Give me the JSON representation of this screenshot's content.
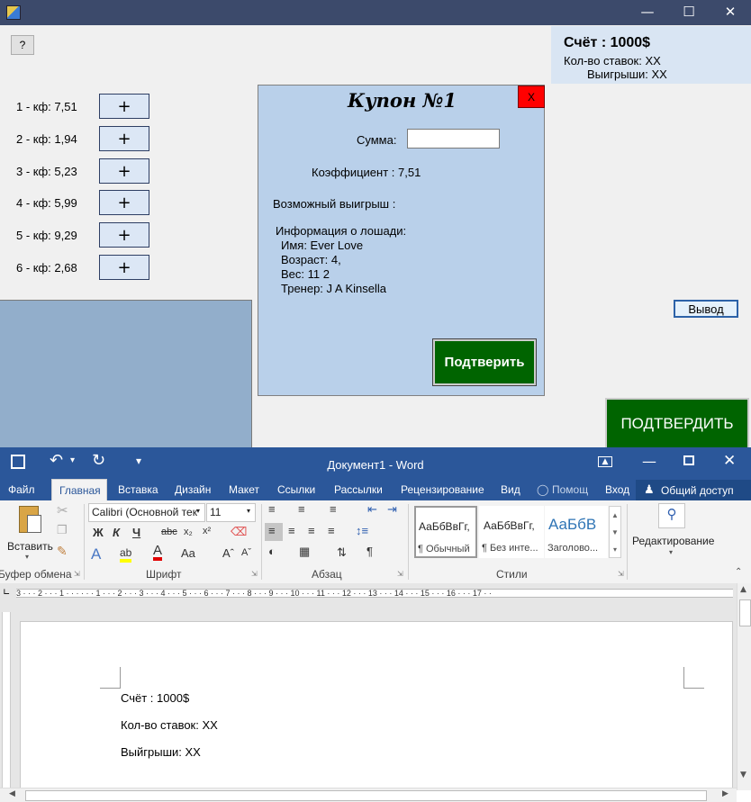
{
  "app": {
    "help_label": "?",
    "balance": {
      "title": "Счёт : 1000$",
      "bets": "Кол-во ставок: XX",
      "wins": "Выигрыши: XX"
    },
    "odds": [
      {
        "label": "1 - кф: 7,51",
        "button": "+"
      },
      {
        "label": "2 - кф: 1,94",
        "button": "+"
      },
      {
        "label": "3 - кф: 5,23",
        "button": "+"
      },
      {
        "label": "4 - кф: 5,99",
        "button": "+"
      },
      {
        "label": "5 - кф: 9,29",
        "button": "+"
      },
      {
        "label": "6 - кф: 2,68",
        "button": "+"
      }
    ],
    "coupon": {
      "title": "Купон №1",
      "close": "X",
      "sum_label": "Сумма:",
      "sum_value": "",
      "coef": "Коэффициент : 7,51",
      "win": "Возможный выигрыш :",
      "info_title": "Информация о лошади:",
      "name": "Имя: Ever Love",
      "age": "Возраст: 4,",
      "weight": "Вес: 11 2",
      "trainer": "Тренер: J A Kinsella",
      "confirm": "Подтверить"
    },
    "confirm_big": "ПОДТВЕРДИТЬ",
    "output": "Вывод",
    "colors": {
      "confirm": "#006400",
      "coupon_bg": "#b9d0ea",
      "close": "#ff0000"
    }
  },
  "word": {
    "title": "Документ1 - Word",
    "tabs": [
      "Файл",
      "Главная",
      "Вставка",
      "Дизайн",
      "Макет",
      "Ссылки",
      "Рассылки",
      "Рецензирование",
      "Вид",
      "Помощ",
      "Вход"
    ],
    "share": "Общий доступ",
    "clipboard": {
      "paste": "Вставить",
      "label": "Буфер обмена"
    },
    "font": {
      "name": "Calibri (Основной тек",
      "size": "11",
      "label": "Шрифт"
    },
    "paragraph_label": "Абзац",
    "styles": {
      "label": "Стили",
      "items": [
        {
          "sample": "АаБбВвГг,",
          "name": "¶ Обычный"
        },
        {
          "sample": "АаБбВвГг,",
          "name": "¶ Без инте..."
        },
        {
          "sample": "АаБбВ",
          "name": "Заголово..."
        }
      ]
    },
    "editing_label": "Редактирование",
    "ruler_text": "3 · · · 2 · · · 1 · · ·   · · · 1 · · · 2 · · · 3 · · · 4 · · · 5 · · · 6 · · · 7 · · · 8 · · · 9 · · · 10 · · · 11 · · · 12 · · · 13 · · · 14 · · · 15 · · · 16 · · · 17 · ·",
    "doc_lines": [
      "Счёт : 1000$",
      "Кол-во ставок: XX",
      "Выйгрыши: XX"
    ]
  }
}
